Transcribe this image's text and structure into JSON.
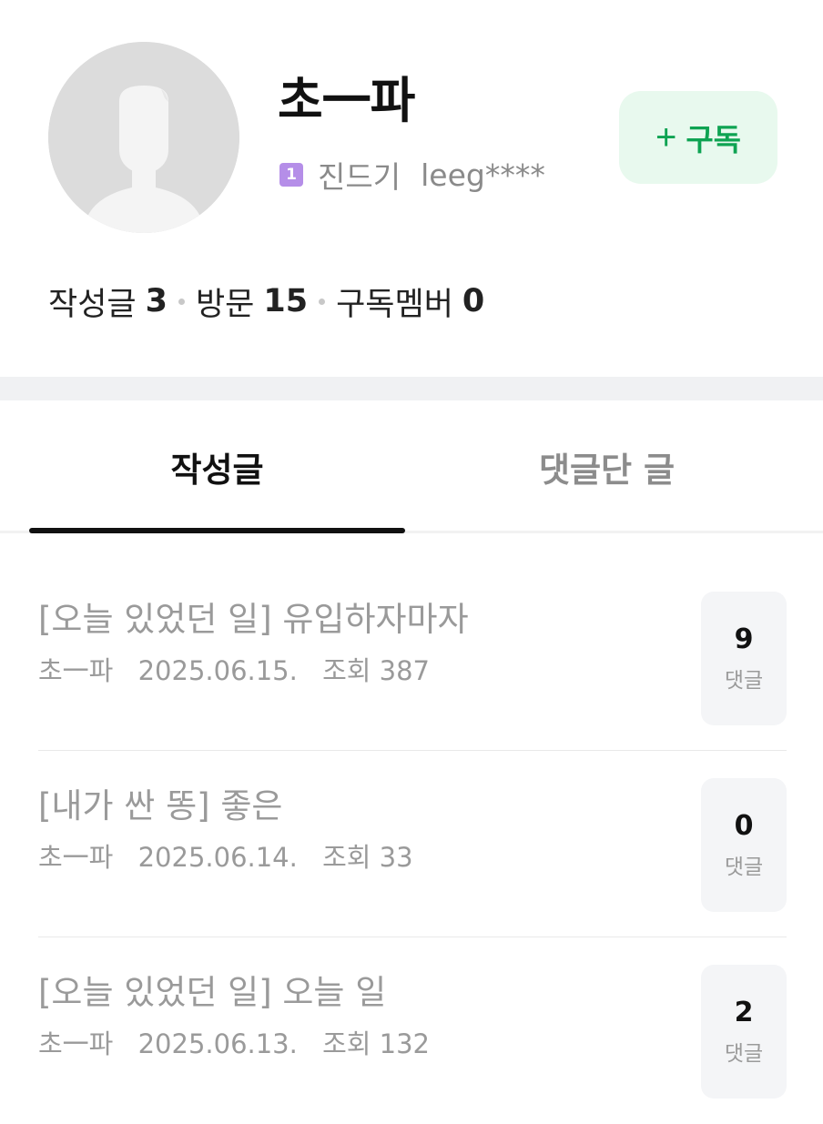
{
  "profile": {
    "nickname": "초一파",
    "grade_badge": "1",
    "grade_name": "진드기",
    "user_id": "leeg****",
    "subscribe_plus": "+",
    "subscribe_label": "구독",
    "stats": [
      {
        "label": "작성글",
        "value": "3"
      },
      {
        "label": "방문",
        "value": "15"
      },
      {
        "label": "구독멤버",
        "value": "0"
      }
    ]
  },
  "tabs": [
    {
      "label": "작성글",
      "active": true
    },
    {
      "label": "댓글단 글",
      "active": false
    }
  ],
  "posts": [
    {
      "title": "[오늘 있었던 일] 유입하자마자",
      "author": "초一파",
      "date": "2025.06.15.",
      "views": "조회 387",
      "comment_count": "9",
      "comment_label": "댓글"
    },
    {
      "title": "[내가 싼 똥] 좋은",
      "author": "초一파",
      "date": "2025.06.14.",
      "views": "조회 33",
      "comment_count": "0",
      "comment_label": "댓글"
    },
    {
      "title": "[오늘 있었던 일] 오늘 일",
      "author": "초一파",
      "date": "2025.06.13.",
      "views": "조회 132",
      "comment_count": "2",
      "comment_label": "댓글"
    }
  ],
  "colors": {
    "accent_green": "#0ea352",
    "subscribe_bg": "#e8f9ee",
    "grade_badge": "#b58ee8"
  },
  "icons": {
    "avatar": "default-person-silhouette",
    "subscribe": "plus-icon"
  }
}
